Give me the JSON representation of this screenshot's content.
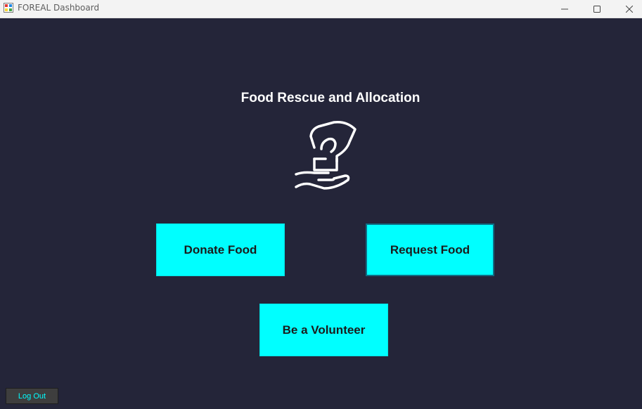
{
  "window": {
    "title": "FOREAL Dashboard",
    "app_icon": "form-app-icon",
    "controls": {
      "minimize_icon": "minimize-icon",
      "maximize_icon": "maximize-icon",
      "close_icon": "close-icon"
    }
  },
  "main": {
    "title": "Food Rescue and Allocation",
    "hero_icon": "hand-giving-food-icon",
    "buttons": {
      "donate": "Donate Food",
      "request": "Request Food",
      "volunteer": "Be a Volunteer"
    }
  },
  "footer": {
    "logout": "Log Out"
  },
  "colors": {
    "background": "#242539",
    "button_fill": "#00ffff",
    "button_text": "#1b1b1b",
    "title_text": "#ffffff",
    "logout_text": "#00ffff",
    "logout_fill": "#3e3e3e"
  }
}
